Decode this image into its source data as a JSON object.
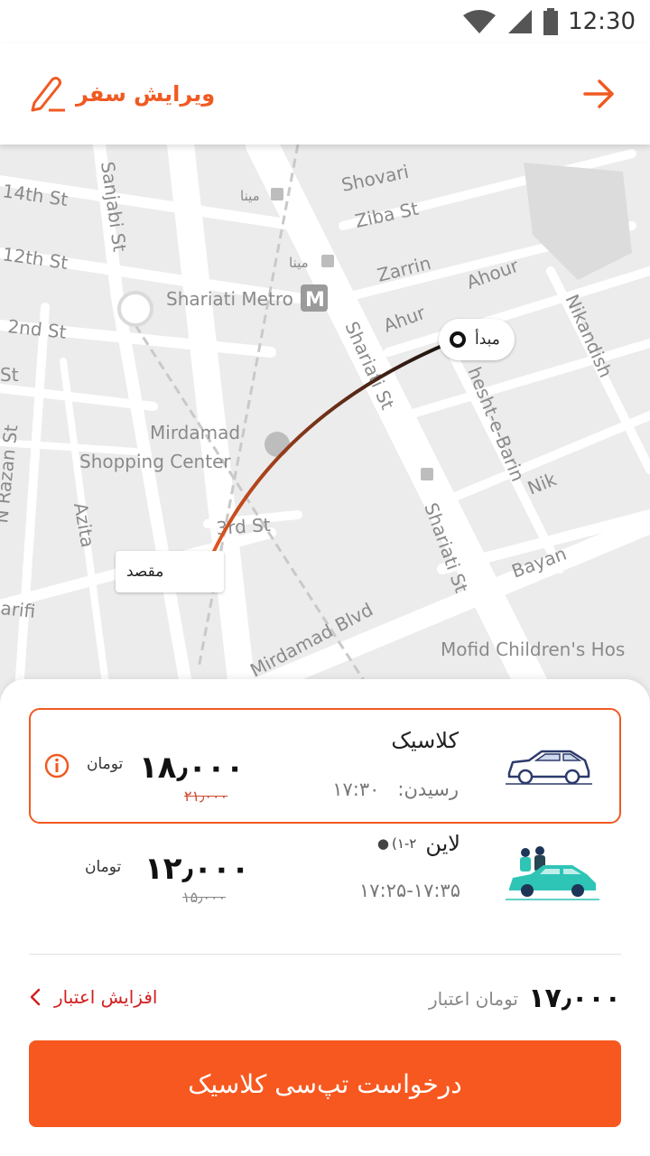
{
  "status_bar": {
    "time": "12:30",
    "icons": [
      "wifi-icon",
      "signal-icon",
      "battery-icon"
    ]
  },
  "header": {
    "edit_trip_label": "ویرایش سفر",
    "edit_icon": "pencil-icon",
    "back_icon": "arrow-forward-icon"
  },
  "colors": {
    "accent": "#f7581f",
    "route_start": "#111111",
    "route_end": "#f05a22",
    "danger": "#d32020"
  },
  "map": {
    "origin_label": "مبدأ",
    "destination_label": "مقصد",
    "street_labels": [
      "14th St",
      "Sanjabi St",
      "12th St",
      "2nd St",
      "St",
      "N Razan St",
      "Azita",
      "arifi",
      "Shovari",
      "Ziba St",
      "Zarrin",
      "Ahour",
      "Ahur",
      "Shariati St",
      "Shariati St",
      "Nikandish",
      "hesht-e-Barin",
      "Nik",
      "Bayan",
      "3rd St",
      "Mirdamad Blvd",
      "Mofid Children's Hos"
    ],
    "poi_labels": [
      "Shariati Metro",
      "Mirdamad",
      "Shopping Center",
      "مینا",
      "مینا"
    ]
  },
  "options": [
    {
      "name": "کلاسیک",
      "time_label": "رسیدن:",
      "time": "۱۷:۳۰",
      "price": "۱۸٫۰۰۰",
      "old_price": "۲۱٫۰۰۰",
      "unit": "تومان",
      "selected": true,
      "info_icon": "info-icon",
      "car_icon": "white-car-icon"
    },
    {
      "name": "لاین",
      "capacity": "(۱-۲",
      "time": "۱۷:۲۵-۱۷:۳۵",
      "price": "۱۲٫۰۰۰",
      "old_price": "۱۵٫۰۰۰",
      "unit": "تومان",
      "selected": false,
      "car_icon": "teal-car-icon"
    }
  ],
  "credit": {
    "amount": "۱۷٫۰۰۰",
    "label": "تومان اعتبار",
    "increase_label": "افزایش اعتبار"
  },
  "request_button": {
    "label": "درخواست تپ‌سی کلاسیک"
  }
}
